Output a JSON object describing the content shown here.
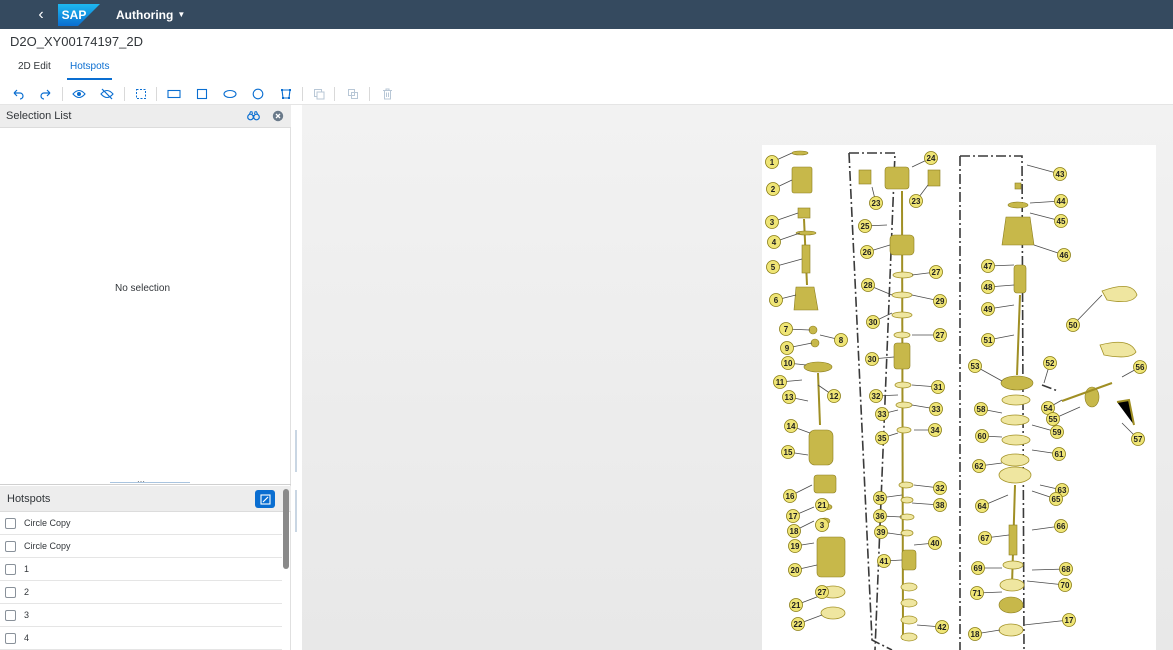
{
  "shell": {
    "brand": "SAP",
    "menu_label": "Authoring"
  },
  "page": {
    "title": "D2O_XY00174197_2D"
  },
  "tabs": [
    {
      "label": "2D Edit"
    },
    {
      "label": "Hotspots"
    }
  ],
  "selection_panel": {
    "title": "Selection List",
    "empty_text": "No selection"
  },
  "hotspots_panel": {
    "title": "Hotspots",
    "items": [
      {
        "label": "Circle Copy"
      },
      {
        "label": "Circle Copy"
      },
      {
        "label": "1"
      },
      {
        "label": "2"
      },
      {
        "label": "3"
      },
      {
        "label": "4"
      }
    ]
  },
  "drawing": {
    "callouts": [
      "1",
      "2",
      "3",
      "4",
      "5",
      "6",
      "7",
      "8",
      "9",
      "10",
      "11",
      "12",
      "13",
      "14",
      "15",
      "16",
      "17",
      "18",
      "19",
      "20",
      "21",
      "22",
      "23",
      "23",
      "24",
      "25",
      "26",
      "27",
      "27",
      "28",
      "28",
      "29",
      "30",
      "30",
      "31",
      "32",
      "32",
      "33",
      "33",
      "34",
      "35",
      "35",
      "36",
      "38",
      "39",
      "40",
      "41",
      "42",
      "43",
      "44",
      "45",
      "46",
      "47",
      "48",
      "49",
      "50",
      "51",
      "52",
      "53",
      "54",
      "55",
      "56",
      "57",
      "58",
      "59",
      "60",
      "61",
      "62",
      "63",
      "64",
      "65",
      "66",
      "67",
      "68",
      "69",
      "70",
      "71",
      "17",
      "18",
      "21",
      "3",
      "27"
    ]
  },
  "colors": {
    "shell": "#354a5f",
    "accent": "#0a6ed1",
    "callout_fill": "#efe576",
    "part": "#c7b84a"
  }
}
